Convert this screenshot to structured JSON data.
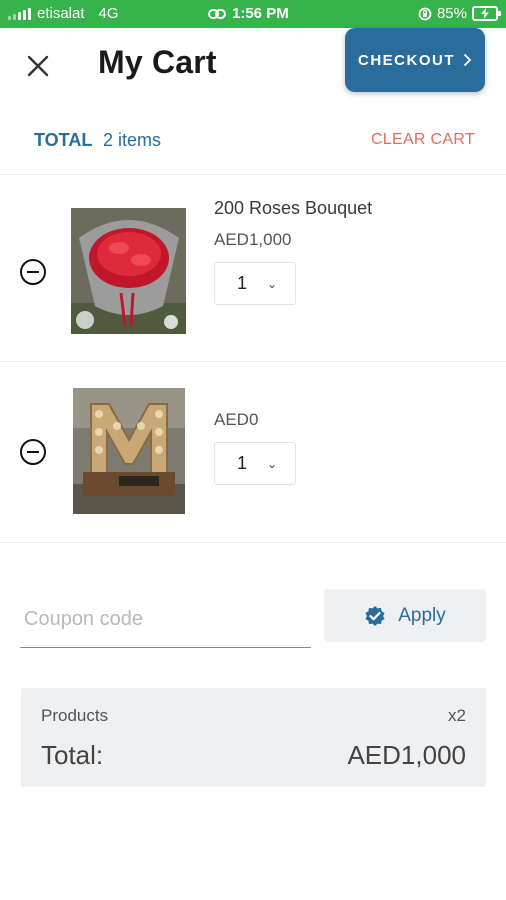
{
  "status_bar": {
    "carrier": "etisalat",
    "network": "4G",
    "time": "1:56 PM",
    "battery": "85%"
  },
  "header": {
    "title": "My Cart",
    "close_icon": "close-icon",
    "checkout_label": "CHECKOUT",
    "checkout_icon": "chevron-right-icon"
  },
  "summary_bar": {
    "total_label": "TOTAL",
    "item_count": "2 items",
    "clear_label": "CLEAR CART"
  },
  "items": [
    {
      "name": "200 Roses Bouquet",
      "price": "AED1,000",
      "quantity": "1"
    },
    {
      "name": "",
      "price": "AED0",
      "quantity": "1"
    }
  ],
  "coupon": {
    "placeholder": "Coupon code",
    "value": "",
    "apply_label": "Apply",
    "apply_icon": "verified-badge-icon"
  },
  "totals": {
    "products_label": "Products",
    "products_count": "x2",
    "total_label": "Total:",
    "total_value": "AED1,000"
  },
  "colors": {
    "status_bar": "#36b34a",
    "brand": "#2a6d9c",
    "clear_cart": "#e86a5e",
    "panel": "#eef0f2"
  }
}
